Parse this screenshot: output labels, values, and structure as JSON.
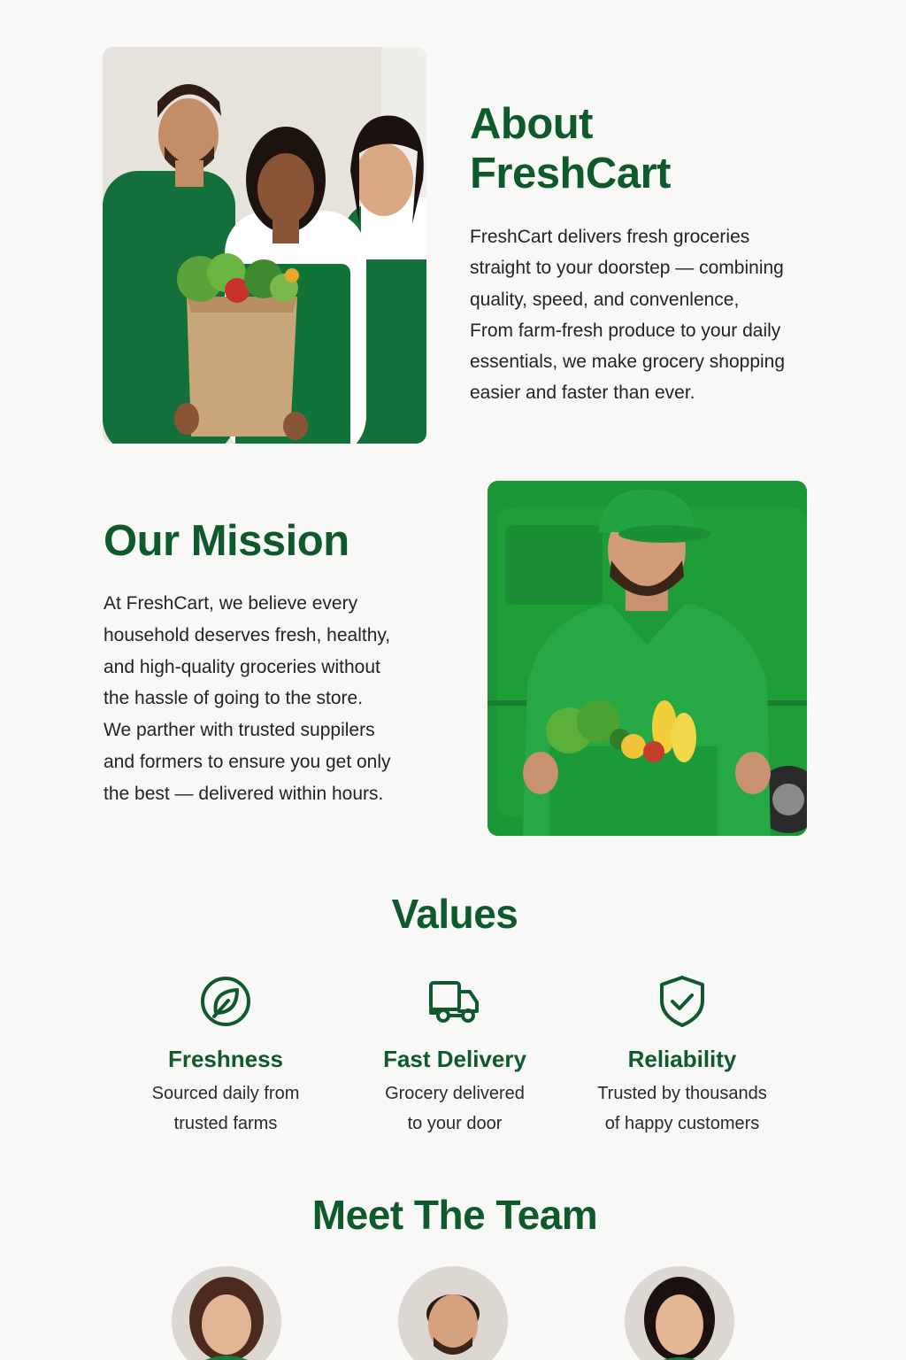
{
  "about": {
    "title_line1": "About",
    "title_line2": "FreshCart",
    "paragraph_lines": [
      "FreshCart delivers fresh groceries",
      "straight to your doorstep — combining",
      "quality, speed, and convenlence,",
      "From farm-fresh produce to your daily",
      "essentials, we make grocery shopping",
      "easier and faster than ever."
    ]
  },
  "mission": {
    "title": "Our Mission",
    "paragraph_lines": [
      "At FreshCart, we believe every",
      "household deserves fresh, healthy,",
      "and high-quality groceries without",
      "the hassle of going to the store.",
      "We parther with trusted suppilers",
      "and formers to ensure you get only",
      "the best — delivered within hours."
    ]
  },
  "values": {
    "title": "Values",
    "items": [
      {
        "icon": "leaf-icon",
        "title": "Freshness",
        "desc_line1": "Sourced daily from",
        "desc_line2": "trusted farms"
      },
      {
        "icon": "truck-icon",
        "title": "Fast Delivery",
        "desc_line1": "Grocery delivered",
        "desc_line2": "to your door"
      },
      {
        "icon": "shield-check-icon",
        "title": "Reliability",
        "desc_line1": "Trusted by thousands",
        "desc_line2": "of happy customers"
      }
    ]
  },
  "team": {
    "title": "Meet The Team"
  },
  "colors": {
    "brand_green": "#0e5a2c",
    "uniform_green": "#1b9a3b",
    "background": "#f8f8f7"
  }
}
